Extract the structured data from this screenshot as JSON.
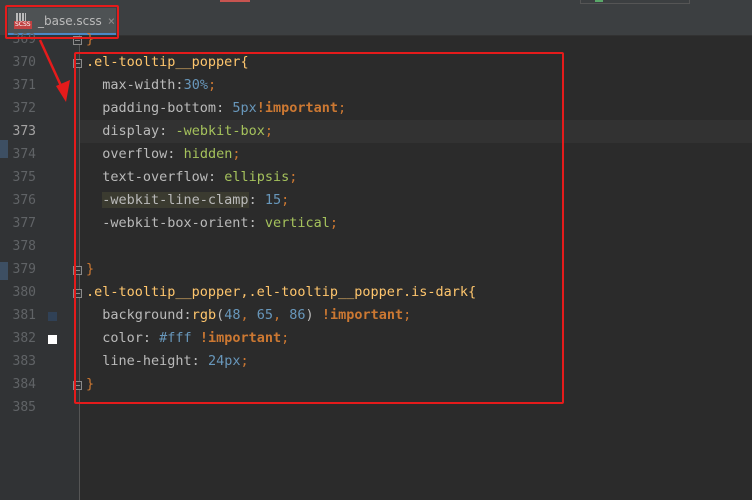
{
  "tab": {
    "title": "_base.scss",
    "close": "×",
    "badge": "SCSS"
  },
  "lines": [
    {
      "n": "369"
    },
    {
      "n": "370"
    },
    {
      "n": "371"
    },
    {
      "n": "372"
    },
    {
      "n": "373"
    },
    {
      "n": "374"
    },
    {
      "n": "375"
    },
    {
      "n": "376"
    },
    {
      "n": "377"
    },
    {
      "n": "378"
    },
    {
      "n": "379"
    },
    {
      "n": "380"
    },
    {
      "n": "381"
    },
    {
      "n": "382"
    },
    {
      "n": "383"
    },
    {
      "n": "384"
    },
    {
      "n": "385"
    }
  ],
  "code": {
    "l369_brace": "}",
    "l370_sel": ".el-tooltip__popper",
    "l370_brace": "{",
    "l371_prop": "max-width",
    "l371_colon": ":",
    "l371_num": "30",
    "l371_unit": "%",
    "l371_semi": ";",
    "l372_prop": "padding-bottom",
    "l372_colon": ": ",
    "l372_num": "5",
    "l372_unit": "px",
    "l372_kw": "!important",
    "l372_semi": ";",
    "l373_prop": "display",
    "l373_colon": ": ",
    "l373_val": "-webkit-box",
    "l373_semi": ";",
    "l374_prop": "overflow",
    "l374_colon": ": ",
    "l374_val": "hidden",
    "l374_semi": ";",
    "l375_prop": "text-overflow",
    "l375_colon": ": ",
    "l375_val": "ellipsis",
    "l375_semi": ";",
    "l376_prop": "-webkit-line-clamp",
    "l376_colon": ": ",
    "l376_num": "15",
    "l376_semi": ";",
    "l377_prop": "-webkit-box-orient",
    "l377_colon": ": ",
    "l377_val": "vertical",
    "l377_semi": ";",
    "l379_brace": "}",
    "l380_sel": ".el-tooltip__popper,.el-tooltip__popper.is-dark",
    "l380_brace": "{",
    "l381_prop": "background",
    "l381_colon": ":",
    "l381_fn": "rgb",
    "l381_open": "(",
    "l381_a": "48",
    "l381_c1": ", ",
    "l381_b": "65",
    "l381_c2": ", ",
    "l381_c": "86",
    "l381_close": ") ",
    "l381_kw": "!important",
    "l381_semi": ";",
    "l382_prop": "color",
    "l382_colon": ": ",
    "l382_num": "#fff",
    "l382_sp": " ",
    "l382_kw": "!important",
    "l382_semi": ";",
    "l383_prop": "line-height",
    "l383_colon": ": ",
    "l383_num": "24",
    "l383_unit": "px",
    "l383_semi": ";",
    "l384_brace": "}"
  },
  "colors": {
    "swatch_381": "#304156",
    "swatch_382": "#ffffff",
    "annotation": "#e51b1b"
  }
}
